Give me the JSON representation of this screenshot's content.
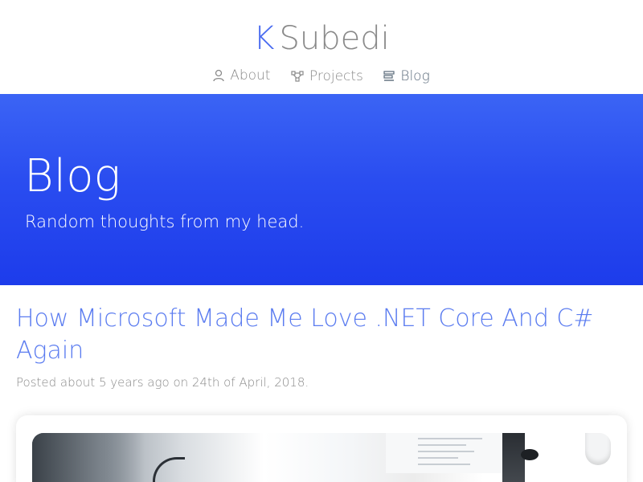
{
  "brand": {
    "initial": "K",
    "rest": "Subedi"
  },
  "nav": {
    "items": [
      {
        "label": "About",
        "icon": "user-icon"
      },
      {
        "label": "Projects",
        "icon": "projects-icon"
      },
      {
        "label": "Blog",
        "icon": "blog-icon"
      }
    ]
  },
  "hero": {
    "title": "Blog",
    "subtitle": "Random thoughts from my head."
  },
  "post": {
    "title": "How Microsoft Made Me Love .NET Core And C# Again",
    "meta": "Posted about 5 years ago on 24th of April, 2018."
  },
  "colors": {
    "accent": "#5b7cf0",
    "hero_top": "#3b64f5",
    "hero_bottom": "#1d3ceb",
    "muted_text": "#8a8a8a"
  }
}
